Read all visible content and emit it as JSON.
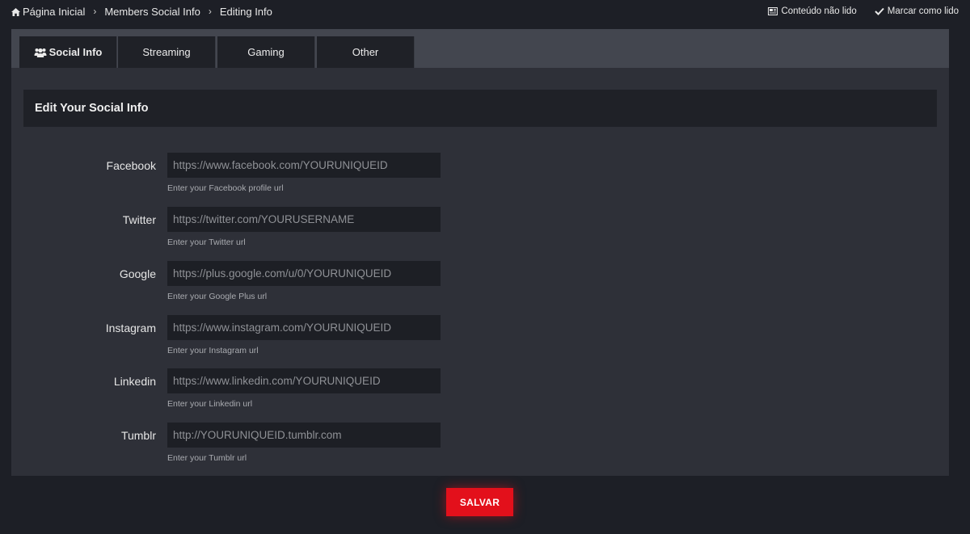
{
  "breadcrumb": {
    "items": [
      "Página Inicial",
      "Members Social Info",
      "Editing Info"
    ]
  },
  "actions": {
    "unread_content": "Conteúdo não lido",
    "mark_read": "Marcar como lido"
  },
  "tabs": [
    {
      "label": "Social Info",
      "active": true
    },
    {
      "label": "Streaming",
      "active": false
    },
    {
      "label": "Gaming",
      "active": false
    },
    {
      "label": "Other",
      "active": false
    }
  ],
  "section": {
    "title": "Edit Your Social Info"
  },
  "fields": [
    {
      "label": "Facebook",
      "placeholder": "https://www.facebook.com/YOURUNIQUEID",
      "hint": "Enter your Facebook profile url"
    },
    {
      "label": "Twitter",
      "placeholder": "https://twitter.com/YOURUSERNAME",
      "hint": "Enter your Twitter url"
    },
    {
      "label": "Google",
      "placeholder": "https://plus.google.com/u/0/YOURUNIQUEID",
      "hint": "Enter your Google Plus url"
    },
    {
      "label": "Instagram",
      "placeholder": "https://www.instagram.com/YOURUNIQUEID",
      "hint": "Enter your Instagram url"
    },
    {
      "label": "Linkedin",
      "placeholder": "https://www.linkedin.com/YOURUNIQUEID",
      "hint": "Enter your Linkedin url"
    },
    {
      "label": "Tumblr",
      "placeholder": "http://YOURUNIQUEID.tumblr.com",
      "hint": "Enter your Tumblr url"
    }
  ],
  "save": {
    "label": "SALVAR"
  },
  "colors": {
    "accent": "#e3101b",
    "background": "#1d1f26",
    "panel": "#2e3038"
  }
}
